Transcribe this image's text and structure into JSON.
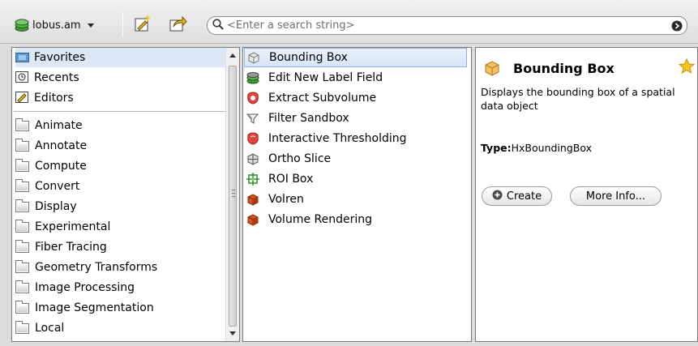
{
  "toolbar": {
    "object_label": "lobus.am",
    "search": {
      "placeholder": "<Enter a search string>"
    }
  },
  "categories": {
    "pinned": [
      {
        "label": "Favorites",
        "icon": "favorites-folder-icon"
      },
      {
        "label": "Recents",
        "icon": "recents-icon"
      },
      {
        "label": "Editors",
        "icon": "editors-icon"
      }
    ],
    "folders": [
      {
        "label": "Animate"
      },
      {
        "label": "Annotate"
      },
      {
        "label": "Compute"
      },
      {
        "label": "Convert"
      },
      {
        "label": "Display"
      },
      {
        "label": "Experimental"
      },
      {
        "label": "Fiber Tracing"
      },
      {
        "label": "Geometry Transforms"
      },
      {
        "label": "Image Processing"
      },
      {
        "label": "Image Segmentation"
      },
      {
        "label": "Local"
      }
    ]
  },
  "modules": [
    {
      "label": "Bounding Box",
      "icon": "bounding-box-icon",
      "selected": true
    },
    {
      "label": "Edit New Label Field",
      "icon": "label-field-icon"
    },
    {
      "label": "Extract Subvolume",
      "icon": "extract-subvolume-icon"
    },
    {
      "label": "Filter Sandbox",
      "icon": "filter-sandbox-icon"
    },
    {
      "label": "Interactive Thresholding",
      "icon": "thresholding-icon"
    },
    {
      "label": "Ortho Slice",
      "icon": "ortho-slice-icon"
    },
    {
      "label": "ROI Box",
      "icon": "roi-box-icon"
    },
    {
      "label": "Volren",
      "icon": "volren-icon"
    },
    {
      "label": "Volume Rendering",
      "icon": "volume-rendering-icon"
    }
  ],
  "details": {
    "title": "Bounding Box",
    "description": "Displays the bounding box of a spatial data object",
    "type_label": "Type:",
    "type_value": "HxBoundingBox",
    "create_label": "Create",
    "more_info_label": "More Info..."
  },
  "colors": {
    "selection": "#d6e5f8",
    "selection_border": "#8fb3e0",
    "favorite_star": "#f5c518",
    "volren_orange": "#d9531e",
    "thresholding_red": "#e0453a"
  }
}
